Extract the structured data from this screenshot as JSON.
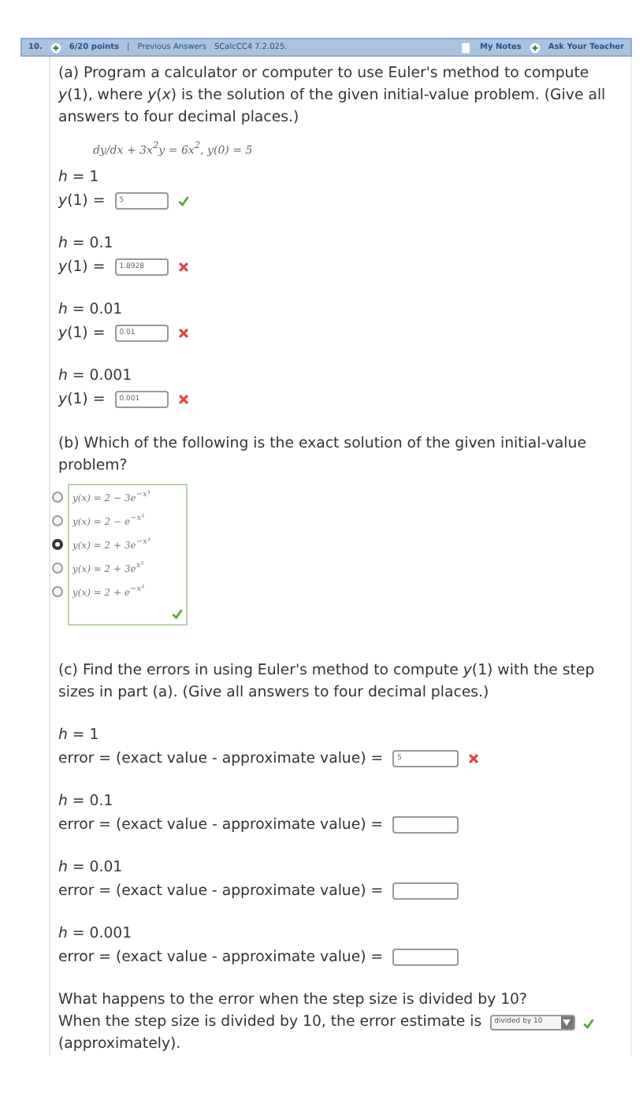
{
  "header": {
    "number": "10.",
    "points": "6/20 points",
    "separator": "|",
    "previous": "Previous Answers",
    "source": "SCalcCC4 7.2.025.",
    "notes": "My Notes",
    "ask": "Ask Your Teacher"
  },
  "part_a": {
    "prompt": "(a) Program a calculator or computer to use Euler's method to compute *y*(1), where *y*(*x*) is the solution of the given initial-value problem. (Give all answers to four decimal places.)",
    "equation": "dy/dx + 3x$^{2}$y = 6x$^{2}$,  y(0) = 5",
    "answers": [
      {
        "step": "*h* = 1",
        "label": "*y*(1) =",
        "value": "5",
        "correct": true
      },
      {
        "step": "*h* = 0.1",
        "label": "*y*(1) =",
        "value": "1.8928",
        "correct": false
      },
      {
        "step": "*h* = 0.01",
        "label": "*y*(1) =",
        "value": "0.01",
        "correct": false
      },
      {
        "step": "*h* = 0.001",
        "label": "*y*(1) =",
        "value": "0.001",
        "correct": false
      }
    ]
  },
  "part_b": {
    "prompt": "(b) Which of the following is the exact solution of the given initial-value problem?",
    "correct": true,
    "options": [
      {
        "text": "y(x) = 2 − 3e$^{−x³}$",
        "selected": false
      },
      {
        "text": "y(x) = 2 − e$^{−x³}$",
        "selected": false
      },
      {
        "text": "y(x) = 2 + 3e$^{−x³}$",
        "selected": true
      },
      {
        "text": "y(x) = 2 + 3e$^{x³}$",
        "selected": false
      },
      {
        "text": "y(x) = 2 + e$^{−x³}$",
        "selected": false
      }
    ]
  },
  "part_c": {
    "prompt": "(c) Find the errors in using Euler's method to compute *y*(1) with the step sizes in part (a). (Give all answers to four decimal places.)",
    "answers": [
      {
        "step": "*h* = 1",
        "label": "error = (exact value - approximate value) =",
        "value": "5",
        "correct": false
      },
      {
        "step": "*h* = 0.1",
        "label": "error = (exact value - approximate value) ="
      },
      {
        "step": "*h* = 0.01",
        "label": "error = (exact value - approximate value) ="
      },
      {
        "step": "*h* = 0.001",
        "label": "error = (exact value - approximate value) ="
      }
    ],
    "question": "What happens to the error when the step size is divided by 10?",
    "sentence_start": "When the step size is divided by 10, the error estimate is",
    "dropdown": "divided by 10",
    "dropdown_correct": true,
    "sentence_end": "(approximately)."
  }
}
